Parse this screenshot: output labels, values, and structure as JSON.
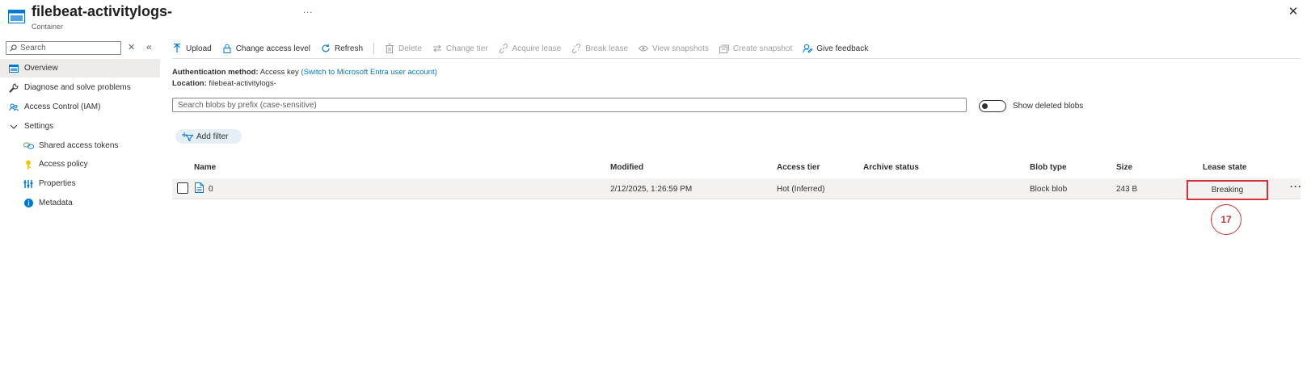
{
  "header": {
    "title": "filebeat-activitylogs-",
    "subtitle": "Container",
    "more": "...",
    "close": "✕"
  },
  "sidebar": {
    "search_placeholder": "Search",
    "clear": "✕",
    "collapse": "«",
    "items": [
      {
        "label": "Overview",
        "icon": "container-icon",
        "active": true
      },
      {
        "label": "Diagnose and solve problems",
        "icon": "wrench-icon"
      },
      {
        "label": "Access Control (IAM)",
        "icon": "people-icon"
      },
      {
        "label": "Settings",
        "icon": "chevron-down-icon"
      },
      {
        "label": "Shared access tokens",
        "icon": "link-icon"
      },
      {
        "label": "Access policy",
        "icon": "key-icon"
      },
      {
        "label": "Properties",
        "icon": "sliders-icon"
      },
      {
        "label": "Metadata",
        "icon": "info-icon"
      }
    ]
  },
  "toolbar": {
    "upload": "Upload",
    "change_access_level": "Change access level",
    "refresh": "Refresh",
    "delete": "Delete",
    "change_tier": "Change tier",
    "acquire_lease": "Acquire lease",
    "break_lease": "Break lease",
    "view_snapshots": "View snapshots",
    "create_snapshot": "Create snapshot",
    "give_feedback": "Give feedback"
  },
  "info": {
    "auth_label": "Authentication method:",
    "auth_value": "Access key",
    "auth_link": "(Switch to Microsoft Entra user account)",
    "location_label": "Location:",
    "location_value": "filebeat-activitylogs-"
  },
  "blob_search_placeholder": "Search blobs by prefix (case-sensitive)",
  "show_deleted": {
    "label": "Show deleted blobs",
    "on": false
  },
  "add_filter": "Add filter",
  "table": {
    "columns": [
      "Name",
      "Modified",
      "Access tier",
      "Archive status",
      "Blob type",
      "Size",
      "Lease state"
    ],
    "rows": [
      {
        "name": "0",
        "modified": "2/12/2025, 1:26:59 PM",
        "access_tier": "Hot (Inferred)",
        "archive_status": "",
        "blob_type": "Block blob",
        "size": "243 B",
        "lease_state": "Breaking"
      }
    ],
    "row_more": "···"
  },
  "annotation": {
    "marker": "17",
    "color": "#d13438"
  },
  "colors": {
    "accent": "#0078d4",
    "highlight": "#d13438",
    "active_nav": "#edebe9"
  }
}
